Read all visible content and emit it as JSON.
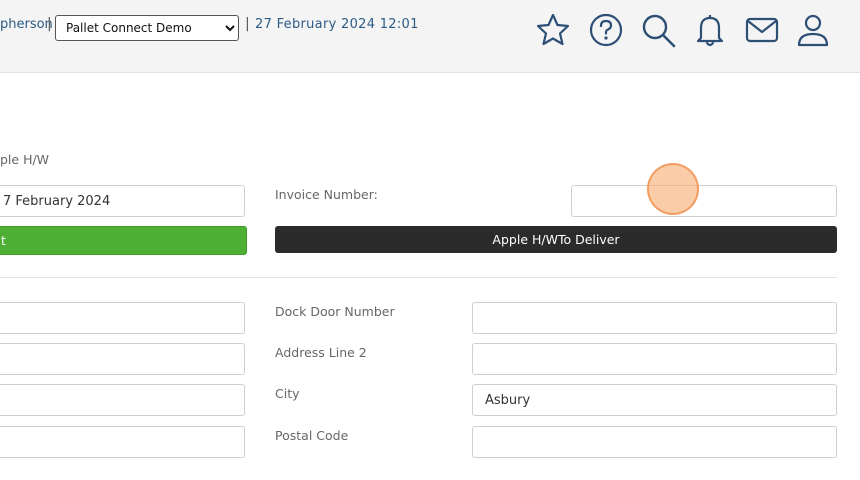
{
  "header": {
    "user_name_partial": "pherson",
    "separator": "|",
    "company_select": {
      "value": "Pallet Connect Demo",
      "options": [
        "Pallet Connect Demo"
      ]
    },
    "datetime": "27 February 2024 12:01",
    "icons": [
      "star-icon",
      "help-icon",
      "search-icon",
      "bell-icon",
      "mail-icon",
      "user-icon"
    ]
  },
  "form": {
    "customer_label_partial": "ple H/W",
    "date_value": "7 February 2024",
    "invoice_label": "Invoice Number:",
    "invoice_value": "",
    "green_button_label_partial": "t",
    "deliver_button_label": "Apple H/WTo Deliver",
    "left_fields": [
      "",
      "",
      "",
      ""
    ],
    "dock_door_label": "Dock Door Number",
    "dock_door_value": "",
    "address2_label": "Address Line 2",
    "address2_value": "",
    "city_label": "City",
    "city_value": "Asbury",
    "postal_label": "Postal Code",
    "postal_value": ""
  }
}
